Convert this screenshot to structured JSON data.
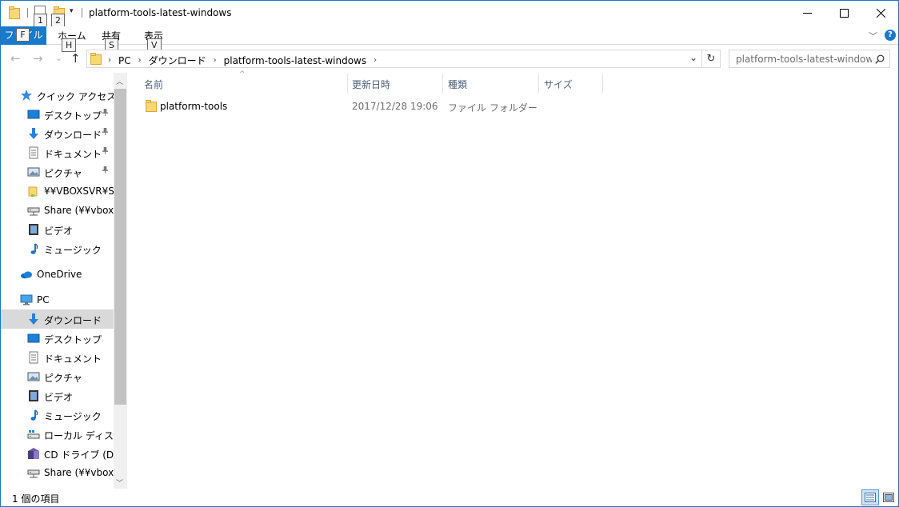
{
  "window": {
    "title": "platform-tools-latest-windows",
    "minimize_glyph": "—",
    "maximize_glyph": "☐",
    "close_glyph": "✕"
  },
  "quick_access_toolbar": {
    "keytip_1": "1",
    "keytip_2": "2",
    "dropdown_glyph": "▾"
  },
  "ribbon": {
    "file_tab": "ファイル",
    "file_keytip": "F",
    "tabs": [
      {
        "label": "ホーム",
        "keytip": "H"
      },
      {
        "label": "共有",
        "keytip": "S"
      },
      {
        "label": "表示",
        "keytip": "V"
      }
    ],
    "expand_glyph": "﹀",
    "help_glyph": "?"
  },
  "navigation": {
    "back_glyph": "←",
    "forward_glyph": "→",
    "recent_glyph": "⌄",
    "up_glyph": "↑",
    "breadcrumb": [
      "PC",
      "ダウンロード",
      "platform-tools-latest-windows"
    ],
    "breadcrumb_sep": "›",
    "address_dropdown_glyph": "⌄",
    "refresh_glyph": "↻",
    "search_placeholder": "platform-tools-latest-window...",
    "search_glyph": "⚲"
  },
  "nav_pane": {
    "items": [
      {
        "label": "クイック アクセス",
        "icon": "star-icon",
        "level": 0
      },
      {
        "label": "デスクトップ",
        "icon": "desktop-icon",
        "level": 1,
        "pinned": true
      },
      {
        "label": "ダウンロード",
        "icon": "download-icon",
        "level": 1,
        "pinned": true
      },
      {
        "label": "ドキュメント",
        "icon": "document-icon",
        "level": 1,
        "pinned": true
      },
      {
        "label": "ピクチャ",
        "icon": "picture-icon",
        "level": 1,
        "pinned": true
      },
      {
        "label": "¥¥VBOXSVR¥Sha",
        "icon": "folder-icon",
        "level": 1
      },
      {
        "label": "Share (¥¥vboxsr",
        "icon": "network-drive-icon",
        "level": 1
      },
      {
        "label": "ビデオ",
        "icon": "video-icon",
        "level": 1
      },
      {
        "label": "ミュージック",
        "icon": "music-icon",
        "level": 1
      },
      {
        "label": "OneDrive",
        "icon": "cloud-icon",
        "level": 0
      },
      {
        "label": "PC",
        "icon": "pc-icon",
        "level": 0
      },
      {
        "label": "ダウンロード",
        "icon": "download-icon",
        "level": 1,
        "selected": true
      },
      {
        "label": "デスクトップ",
        "icon": "desktop-icon",
        "level": 1
      },
      {
        "label": "ドキュメント",
        "icon": "document-icon",
        "level": 1
      },
      {
        "label": "ピクチャ",
        "icon": "picture-icon",
        "level": 1
      },
      {
        "label": "ビデオ",
        "icon": "video-icon",
        "level": 1
      },
      {
        "label": "ミュージック",
        "icon": "music-icon",
        "level": 1
      },
      {
        "label": "ローカル ディスク (C",
        "icon": "local-disk-icon",
        "level": 1
      },
      {
        "label": "CD ドライブ (D:) Vi",
        "icon": "cd-drive-icon",
        "level": 1
      },
      {
        "label": "Share (¥¥vboxsr",
        "icon": "network-drive-icon",
        "level": 1
      }
    ],
    "pin_glyph": "📌",
    "scroll_up_glyph": "︿",
    "scroll_down_glyph": "﹀"
  },
  "file_list": {
    "columns": [
      "名前",
      "更新日時",
      "種類",
      "サイズ"
    ],
    "sort_glyph": "^",
    "rows": [
      {
        "name": "platform-tools",
        "modified": "2017/12/28 19:06",
        "type": "ファイル フォルダー",
        "size": ""
      }
    ]
  },
  "status_bar": {
    "item_count": "1 個の項目"
  },
  "colors": {
    "accent": "#1979ca",
    "folder": "#f8d775",
    "selected_bg": "#d9d9d9"
  }
}
